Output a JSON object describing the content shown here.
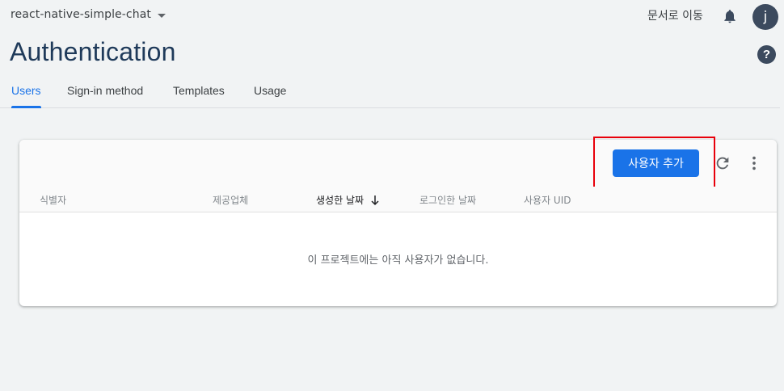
{
  "header": {
    "project_name": "react-native-simple-chat",
    "docs_link": "문서로 이동",
    "avatar_letter": "j"
  },
  "page": {
    "title": "Authentication",
    "help_symbol": "?"
  },
  "tabs": [
    {
      "label": "Users",
      "active": true
    },
    {
      "label": "Sign-in method",
      "active": false
    },
    {
      "label": "Templates",
      "active": false
    },
    {
      "label": "Usage",
      "active": false
    }
  ],
  "users_table": {
    "add_user_label": "사용자 추가",
    "columns": [
      {
        "label": "식별자"
      },
      {
        "label": "제공업체"
      },
      {
        "label": "생성한 날짜",
        "sort": "descending"
      },
      {
        "label": "로그인한 날짜"
      },
      {
        "label": "사용자 UID"
      }
    ],
    "empty_message": "이 프로젝트에는 아직 사용자가 없습니다."
  },
  "colors": {
    "accent": "#1a73e8",
    "highlight": "#e8000b",
    "title": "#1f3a5a"
  },
  "icons": {
    "project_dropdown": "chevron-down-icon",
    "notifications": "bell-icon",
    "help": "help-icon",
    "refresh": "refresh-icon",
    "more": "more-vert-icon",
    "sort": "arrow-down-icon"
  }
}
